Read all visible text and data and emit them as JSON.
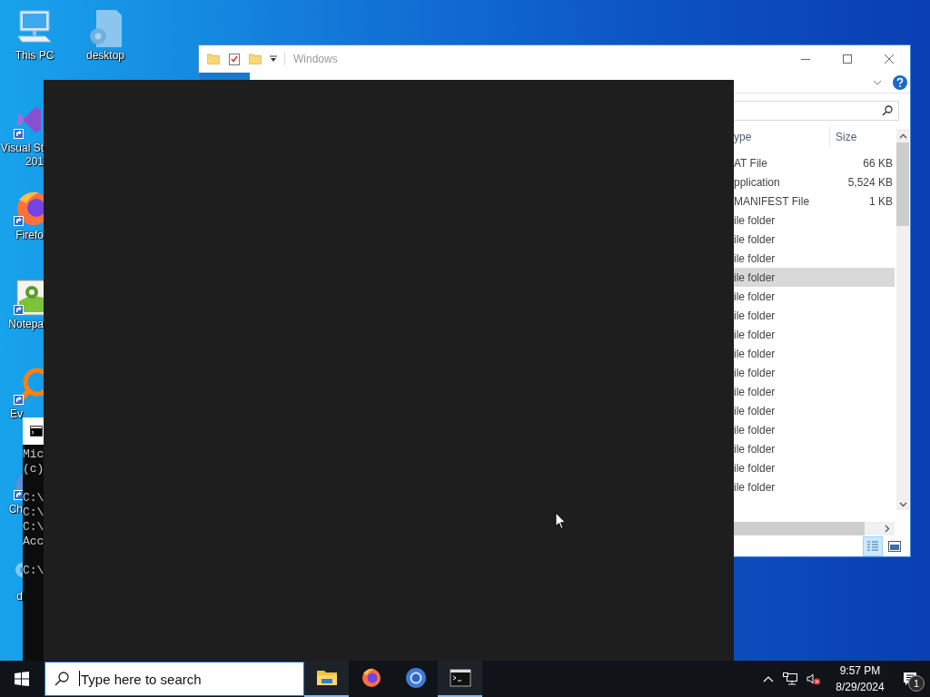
{
  "desktop": {
    "icons": [
      {
        "kind": "pc",
        "lines": [
          "This PC"
        ]
      },
      {
        "kind": "settings-file",
        "lines": [
          "desktop"
        ]
      },
      {
        "kind": "vs",
        "lines": [
          "Visual St",
          "201"
        ]
      },
      {
        "kind": "firefox",
        "lines": [
          "Firefo"
        ]
      },
      {
        "kind": "notepad",
        "lines": [
          "Notepa"
        ]
      },
      {
        "kind": "everything",
        "lines": [
          "Ev"
        ]
      },
      {
        "kind": "chrome",
        "lines": [
          "Ch"
        ]
      },
      {
        "kind": "gear-file",
        "lines": [
          "d"
        ]
      }
    ]
  },
  "cmd_window": {
    "blocks": [
      [
        "Mic",
        "(c)"
      ],
      [
        "C:\\",
        "C:\\",
        "C:\\",
        "Acc"
      ],
      [
        "C:\\"
      ]
    ]
  },
  "explorer": {
    "title": "Windows",
    "columns": [
      "ype",
      "Size"
    ],
    "rows": [
      {
        "type": "AT File",
        "size": "66 KB",
        "selected": false
      },
      {
        "type": "pplication",
        "size": "5,524 KB",
        "selected": false
      },
      {
        "type": "MANIFEST File",
        "size": "1 KB",
        "selected": false
      },
      {
        "type": "ile folder",
        "selected": false
      },
      {
        "type": "ile folder",
        "selected": false
      },
      {
        "type": "ile folder",
        "selected": false
      },
      {
        "type": "ile folder",
        "selected": true
      },
      {
        "type": "ile folder",
        "selected": false
      },
      {
        "type": "ile folder",
        "selected": false
      },
      {
        "type": "ile folder",
        "selected": false
      },
      {
        "type": "ile folder",
        "selected": false
      },
      {
        "type": "ile folder",
        "selected": false
      },
      {
        "type": "ile folder",
        "selected": false
      },
      {
        "type": "ile folder",
        "selected": false
      },
      {
        "type": "ile folder",
        "selected": false
      },
      {
        "type": "ile folder",
        "selected": false
      },
      {
        "type": "ile folder",
        "selected": false
      },
      {
        "type": "ile folder",
        "selected": false
      }
    ],
    "views": [
      {
        "kind": "details",
        "selected": true
      },
      {
        "kind": "large-icons",
        "selected": false
      }
    ]
  },
  "taskbar": {
    "search": {
      "placeholder": "Type here to search"
    },
    "apps": [
      {
        "kind": "explorer",
        "running": true
      },
      {
        "kind": "firefox",
        "running": false
      },
      {
        "kind": "chrome",
        "running": false
      },
      {
        "kind": "cmd",
        "running": true
      }
    ],
    "tray": {
      "muted": true,
      "time": "9:57 PM",
      "date": "8/29/2024",
      "notifications": "1"
    }
  }
}
